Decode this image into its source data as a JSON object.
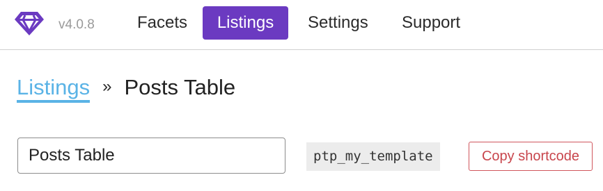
{
  "header": {
    "logo_icon": "diamond-logo-icon",
    "version": "v4.0.8",
    "nav": [
      {
        "label": "Facets",
        "active": false
      },
      {
        "label": "Listings",
        "active": true
      },
      {
        "label": "Settings",
        "active": false
      },
      {
        "label": "Support",
        "active": false
      }
    ]
  },
  "breadcrumb": {
    "parent_label": "Listings",
    "separator": "»",
    "current": "Posts Table"
  },
  "listing": {
    "title_value": "Posts Table",
    "slug": "ptp_my_template",
    "copy_button_label": "Copy shortcode"
  },
  "colors": {
    "accent_purple": "#6b3ac1",
    "link_blue": "#5ab3e6",
    "danger_red": "#c8454c"
  }
}
